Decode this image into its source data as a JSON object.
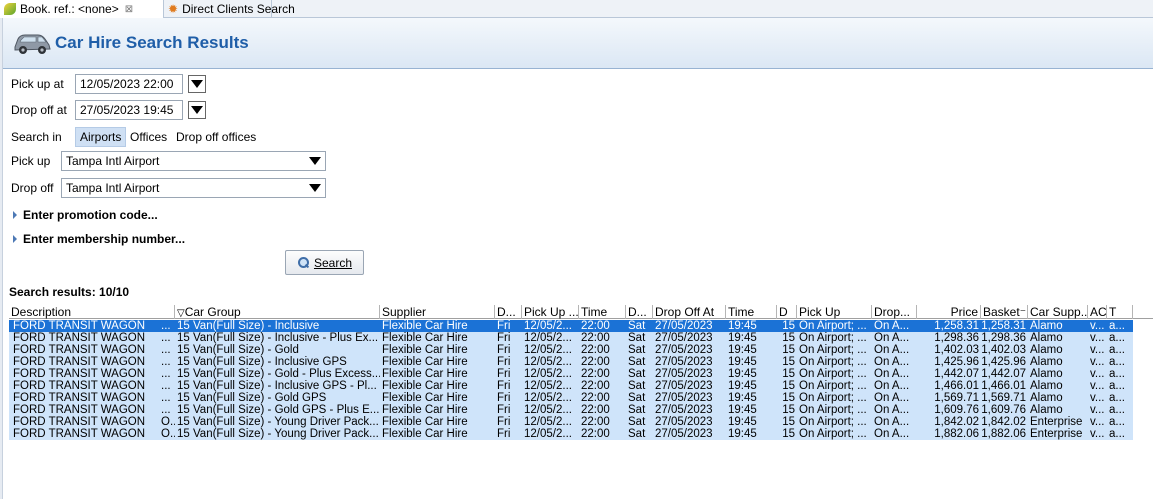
{
  "tabs": [
    {
      "label": "Book. ref.: <none>",
      "close": "⊠",
      "icon": "leaf-icon"
    },
    {
      "label": "Direct Clients Search",
      "icon": "star-icon"
    }
  ],
  "header": {
    "title": "Car Hire Search Results",
    "icon": "car-icon"
  },
  "form": {
    "pickup_at_label": "Pick up at",
    "pickup_at_value": "12/05/2023 22:00",
    "dropoff_at_label": "Drop off at",
    "dropoff_at_value": "27/05/2023 19:45",
    "search_in_label": "Search in",
    "search_in_options": [
      "Airports",
      "Offices",
      "Drop off offices"
    ],
    "search_in_selected": "Airports",
    "pickup_label": "Pick up",
    "pickup_value": "Tampa Intl Airport",
    "dropoff_label": "Drop off",
    "dropoff_value": "Tampa Intl Airport",
    "promo_label": "Enter promotion code...",
    "membership_label": "Enter membership number...",
    "search_button": "Search"
  },
  "results": {
    "label": "Search results: 10/10",
    "columns": [
      "Description",
      "Car Group",
      "Supplier",
      "D...",
      "Pick Up ...",
      "Time",
      "D...",
      "Drop Off At",
      "Time",
      "D",
      "Pick Up",
      "Drop...",
      "Price",
      "Basket",
      "Car Supp...",
      "AC",
      "T"
    ],
    "rows": [
      [
        "FORD TRANSIT WAGON",
        "...",
        "15 Van(Full Size) - Inclusive",
        "Flexible Car Hire",
        "Fri",
        "12/05/2...",
        "22:00",
        "Sat",
        "27/05/2023",
        "19:45",
        "15",
        "On Airport; ...",
        "On A...",
        "1,258.31",
        "1,258.31",
        "Alamo",
        "v...",
        "a..."
      ],
      [
        "FORD TRANSIT WAGON",
        "...",
        "15 Van(Full Size) - Inclusive - Plus Ex...",
        "Flexible Car Hire",
        "Fri",
        "12/05/2...",
        "22:00",
        "Sat",
        "27/05/2023",
        "19:45",
        "15",
        "On Airport; ...",
        "On A...",
        "1,298.36",
        "1,298.36",
        "Alamo",
        "v...",
        "a..."
      ],
      [
        "FORD TRANSIT WAGON",
        "...",
        "15 Van(Full Size) - Gold",
        "Flexible Car Hire",
        "Fri",
        "12/05/2...",
        "22:00",
        "Sat",
        "27/05/2023",
        "19:45",
        "15",
        "On Airport; ...",
        "On A...",
        "1,402.03",
        "1,402.03",
        "Alamo",
        "v...",
        "a..."
      ],
      [
        "FORD TRANSIT WAGON",
        "...",
        "15 Van(Full Size) - Inclusive GPS",
        "Flexible Car Hire",
        "Fri",
        "12/05/2...",
        "22:00",
        "Sat",
        "27/05/2023",
        "19:45",
        "15",
        "On Airport; ...",
        "On A...",
        "1,425.96",
        "1,425.96",
        "Alamo",
        "v...",
        "a..."
      ],
      [
        "FORD TRANSIT WAGON",
        "...",
        "15 Van(Full Size) - Gold - Plus Excess...",
        "Flexible Car Hire",
        "Fri",
        "12/05/2...",
        "22:00",
        "Sat",
        "27/05/2023",
        "19:45",
        "15",
        "On Airport; ...",
        "On A...",
        "1,442.07",
        "1,442.07",
        "Alamo",
        "v...",
        "a..."
      ],
      [
        "FORD TRANSIT WAGON",
        "...",
        "15 Van(Full Size) - Inclusive GPS - Pl...",
        "Flexible Car Hire",
        "Fri",
        "12/05/2...",
        "22:00",
        "Sat",
        "27/05/2023",
        "19:45",
        "15",
        "On Airport; ...",
        "On A...",
        "1,466.01",
        "1,466.01",
        "Alamo",
        "v...",
        "a..."
      ],
      [
        "FORD TRANSIT WAGON",
        "...",
        "15 Van(Full Size) - Gold GPS",
        "Flexible Car Hire",
        "Fri",
        "12/05/2...",
        "22:00",
        "Sat",
        "27/05/2023",
        "19:45",
        "15",
        "On Airport; ...",
        "On A...",
        "1,569.71",
        "1,569.71",
        "Alamo",
        "v...",
        "a..."
      ],
      [
        "FORD TRANSIT WAGON",
        "...",
        "15 Van(Full Size) - Gold GPS - Plus E...",
        "Flexible Car Hire",
        "Fri",
        "12/05/2...",
        "22:00",
        "Sat",
        "27/05/2023",
        "19:45",
        "15",
        "On Airport; ...",
        "On A...",
        "1,609.76",
        "1,609.76",
        "Alamo",
        "v...",
        "a..."
      ],
      [
        "FORD TRANSIT WAGON",
        "O...",
        "15 Van(Full Size) - Young Driver Pack...",
        "Flexible Car Hire",
        "Fri",
        "12/05/2...",
        "22:00",
        "Sat",
        "27/05/2023",
        "19:45",
        "15",
        "On Airport; ...",
        "On A...",
        "1,842.02",
        "1,842.02",
        "Enterprise",
        "v...",
        "a..."
      ],
      [
        "FORD TRANSIT WAGON",
        "O...",
        "15 Van(Full Size) - Young Driver Pack...",
        "Flexible Car Hire",
        "Fri",
        "12/05/2...",
        "22:00",
        "Sat",
        "27/05/2023",
        "19:45",
        "15",
        "On Airport; ...",
        "On A...",
        "1,882.06",
        "1,882.06",
        "Enterprise",
        "v...",
        "a..."
      ]
    ],
    "selected_row": 0
  },
  "colors": {
    "accent": "#1f5ea8",
    "selection": "#1b72d6",
    "row_bg": "#cfe4fa"
  }
}
